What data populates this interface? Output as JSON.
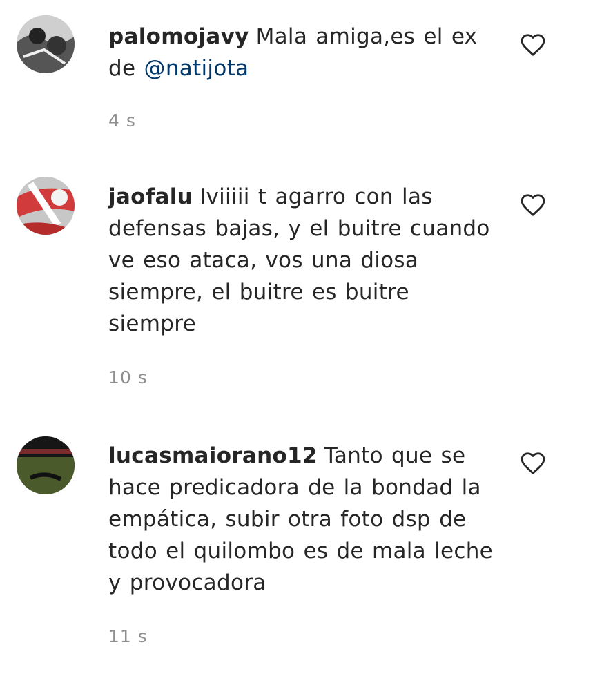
{
  "comments": [
    {
      "username": "palomojavy",
      "text_before": "Mala amiga,es el ex de ",
      "mention": "@natijota",
      "time": "4 s",
      "like_icon": "heart-outline-icon"
    },
    {
      "username": "jaofalu",
      "text": "Iviiiii t agarro con las defensas bajas, y el buitre cuando ve eso ataca, vos una diosa siempre, el buitre es buitre siempre",
      "time": "10 s",
      "like_icon": "heart-outline-icon"
    },
    {
      "username": "lucasmaiorano12",
      "text": "Tanto que se hace predicadora de la bondad la empática, subir otra foto dsp de todo el quilombo es de mala leche y provocadora",
      "time": "11 s",
      "like_icon": "heart-outline-icon"
    }
  ],
  "colors": {
    "text": "#262626",
    "mention": "#00376b",
    "timestamp": "#8e8e8e"
  }
}
